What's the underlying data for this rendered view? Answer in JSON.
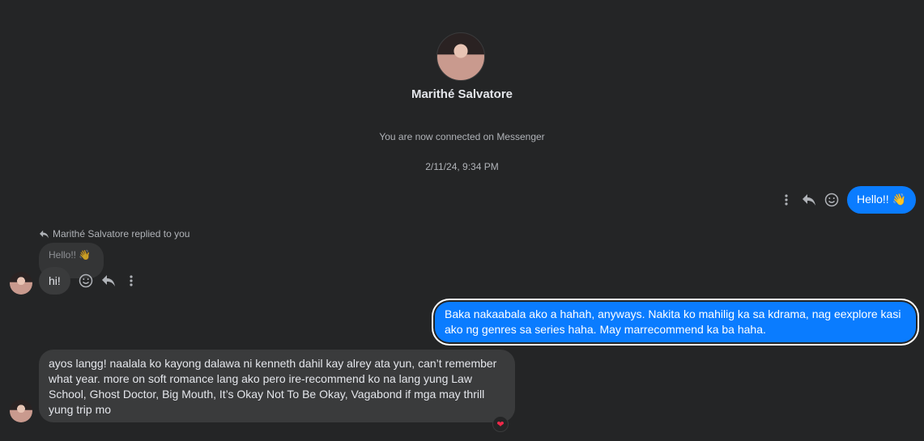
{
  "header": {
    "name": "Marithé Salvatore",
    "connected_text": "You are now connected on Messenger",
    "timestamp": "2/11/24, 9:34 PM"
  },
  "messages": [
    {
      "id": "m1",
      "sender": "me",
      "text": "Hello!! 👋"
    },
    {
      "id": "m2",
      "sender": "them",
      "reply_note": "Marithé Salvatore replied to you",
      "quoted_text": "Hello!! 👋",
      "text": "hi!"
    },
    {
      "id": "m3",
      "sender": "me",
      "text": "Baka nakaabala ako a hahah, anyways. Nakita ko mahilig ka sa kdrama, nag eexplore kasi ako ng genres sa series haha. May marrecommend ka ba haha."
    },
    {
      "id": "m4",
      "sender": "them",
      "text": "ayos langg! naalala ko kayong dalawa ni kenneth dahil kay alrey ata yun, can’t remember what year. more on soft romance lang ako pero ire-recommend ko na lang yung Law School, Ghost Doctor, Big Mouth, It’s Okay Not To Be Okay, Vagabond if mga may thrill yung trip mo",
      "reaction": "❤"
    }
  ],
  "icons": {
    "more": "more-vertical-icon",
    "reply": "reply-icon",
    "react": "smiley-icon",
    "reaction": "heart-icon"
  },
  "colors": {
    "background": "#242526",
    "outgoing_bubble": "#0a7cff",
    "incoming_bubble": "#3a3b3c",
    "secondary_text": "#b0b3b8"
  }
}
